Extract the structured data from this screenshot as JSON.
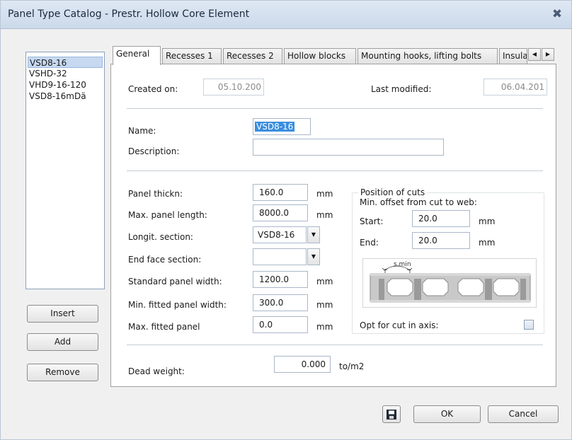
{
  "window": {
    "title": "Panel Type Catalog - Prestr. Hollow Core Element"
  },
  "catalog": {
    "items": [
      "VSD8-16",
      "VSHD-32",
      "VHD9-16-120",
      "VSD8-16mDä"
    ],
    "selected_index": 0,
    "insert_label": "Insert",
    "add_label": "Add",
    "remove_label": "Remove"
  },
  "tabs": [
    "General",
    "Recesses 1",
    "Recesses 2",
    "Hollow blocks",
    "Mounting hooks, lifting bolts",
    "Insula"
  ],
  "general": {
    "created_label": "Created on:",
    "created_value": "05.10.200",
    "modified_label": "Last modified:",
    "modified_value": "06.04.201",
    "name_label": "Name:",
    "name_value": "VSD8-16",
    "description_label": "Description:",
    "description_value": "",
    "panel_thickness_label": "Panel thickn:",
    "panel_thickness_value": "160.0",
    "max_length_label": "Max. panel length:",
    "max_length_value": "8000.0",
    "longit_section_label": "Longit. section:",
    "longit_section_value": "VSD8-16",
    "end_face_label": "End face section:",
    "end_face_value": "",
    "std_width_label": "Standard panel width:",
    "std_width_value": "1200.0",
    "min_fitted_label": "Min. fitted panel width:",
    "min_fitted_value": "300.0",
    "max_fitted_label": "Max. fitted panel",
    "max_fitted_value": "0.0",
    "mm": "mm",
    "dead_weight_label": "Dead weight:",
    "dead_weight_value": "0.000",
    "dead_weight_unit": "to/m2"
  },
  "cuts": {
    "title": "Position of cuts",
    "min_offset_label": "Min. offset from cut to web:",
    "start_label": "Start:",
    "start_value": "20.0",
    "end_label": "End:",
    "end_value": "20.0",
    "mm": "mm",
    "diagram_label": "s,min",
    "opt_label": "Opt for cut in axis:",
    "opt_checked": false
  },
  "footer": {
    "ok_label": "OK",
    "cancel_label": "Cancel",
    "save_icon": "save-icon"
  }
}
